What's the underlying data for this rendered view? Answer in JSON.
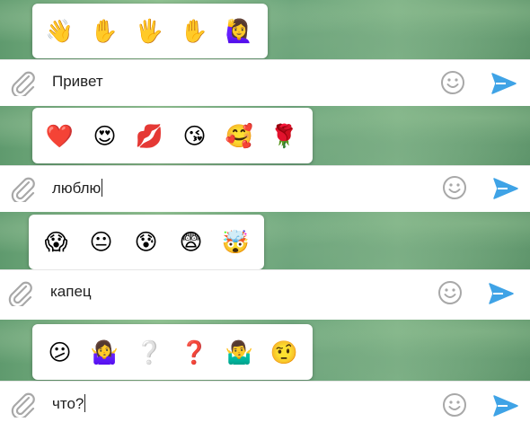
{
  "colors": {
    "send": "#3fa3e6",
    "icon_gray": "#a8a8a8"
  },
  "panels": [
    {
      "text": "Привет",
      "caret": false,
      "emojis": [
        {
          "char": "👋",
          "icon": "waving-hand-icon"
        },
        {
          "char": "✋",
          "icon": "raised-hand-icon"
        },
        {
          "char": "🖐",
          "icon": "hand-fingers-splayed-icon"
        },
        {
          "char": "✋",
          "icon": "raised-hand-icon"
        },
        {
          "char": "🙋‍♀️",
          "icon": "woman-raising-hand-icon"
        }
      ]
    },
    {
      "text": "люблю",
      "caret": true,
      "emojis": [
        {
          "char": "❤️",
          "icon": "red-heart-icon"
        },
        {
          "char": "😍",
          "icon": "heart-eyes-icon"
        },
        {
          "char": "💋",
          "icon": "kiss-mark-icon"
        },
        {
          "char": "😘",
          "icon": "face-blowing-kiss-icon"
        },
        {
          "char": "🥰",
          "icon": "smiling-face-with-hearts-icon"
        },
        {
          "char": "🌹",
          "icon": "rose-icon"
        }
      ]
    },
    {
      "text": "капец",
      "caret": false,
      "emojis": [
        {
          "char": "😱",
          "icon": "face-screaming-icon"
        },
        {
          "char": "😐",
          "icon": "neutral-face-icon"
        },
        {
          "char": "😰",
          "icon": "anxious-face-with-sweat-icon"
        },
        {
          "char": "😨",
          "icon": "fearful-face-icon"
        },
        {
          "char": "🤯",
          "icon": "exploding-head-icon"
        }
      ]
    },
    {
      "text": "что?",
      "caret": true,
      "emojis": [
        {
          "char": "😕",
          "icon": "confused-face-icon"
        },
        {
          "char": "🤷‍♀️",
          "icon": "woman-shrugging-icon"
        },
        {
          "char": "❔",
          "icon": "white-question-mark-icon"
        },
        {
          "char": "❓",
          "icon": "red-question-mark-icon"
        },
        {
          "char": "🤷‍♂️",
          "icon": "man-shrugging-icon"
        },
        {
          "char": "🤨",
          "icon": "raised-eyebrow-icon"
        }
      ]
    }
  ]
}
